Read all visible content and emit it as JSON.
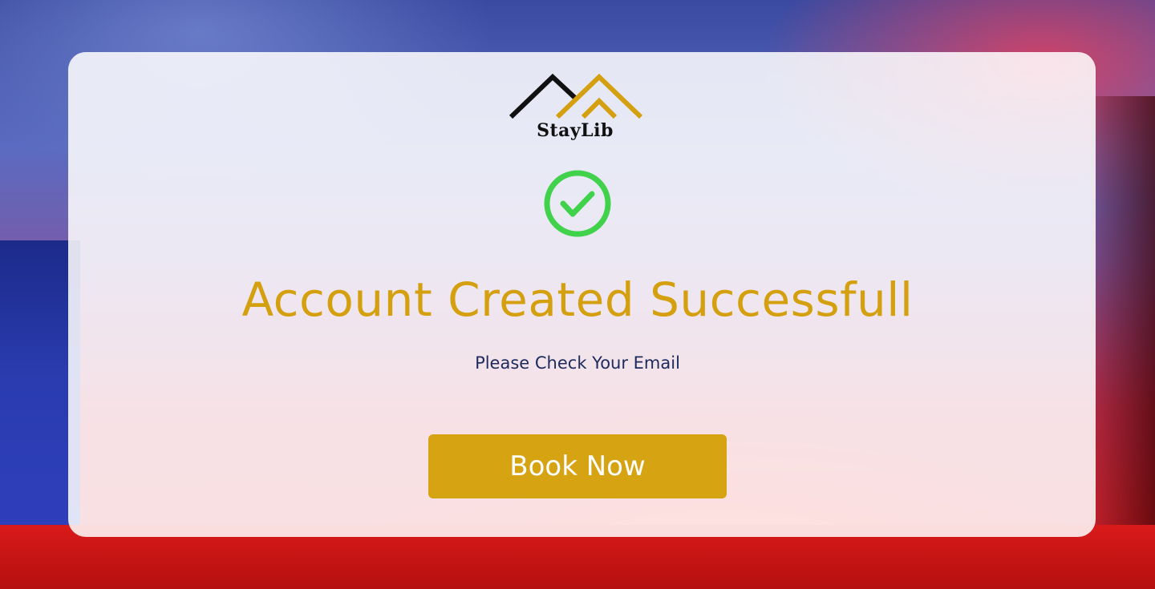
{
  "brand": {
    "name": "StayLib",
    "logo_icon": "roof-mountain-logo",
    "colors": {
      "dark": "#111111",
      "gold": "#d4a00f"
    }
  },
  "status": {
    "icon": "check-circle-icon",
    "color": "#3fd24a"
  },
  "message": {
    "title": "Account Created Successfull",
    "subtitle": "Please Check Your Email"
  },
  "actions": {
    "book_label": "Book Now"
  },
  "colors": {
    "accent": "#d6a312",
    "title": "#d4a00f",
    "subtitle": "#1d2a5c"
  }
}
